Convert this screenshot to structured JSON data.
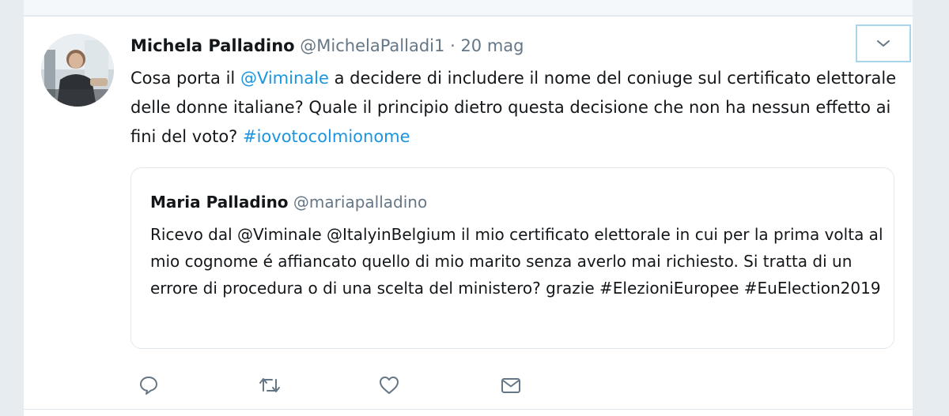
{
  "tweet": {
    "author_name": "Michela Palladino",
    "author_handle": "@MichelaPalladi1",
    "separator": "·",
    "date": "20 mag",
    "text": {
      "part1": "Cosa porta il ",
      "mention": "@Viminale",
      "part2": " a decidere di includere il nome del coniuge sul certificato elettorale delle donne italiane? Quale il principio dietro questa decisione che non ha nessun effetto ai fini del voto? ",
      "hashtag": "#iovotocolmionome"
    },
    "menu_icon": "chevron-down-icon"
  },
  "quoted_tweet": {
    "author_name": "Maria Palladino",
    "author_handle": "@mariapalladino",
    "text": "Ricevo dal @Viminale @ItalyinBelgium il mio certificato elettorale in cui per la prima volta al mio cognome é affiancato quello di mio marito senza averlo mai richiesto. Si tratta di un errore di procedura o di una scelta del ministero? grazie #ElezioniEuropee #EuElection2019"
  },
  "actions": [
    {
      "icon": "reply-icon"
    },
    {
      "icon": "retweet-icon"
    },
    {
      "icon": "like-icon"
    },
    {
      "icon": "direct-message-icon"
    }
  ],
  "colors": {
    "background": "#e6ecf0",
    "card": "#ffffff",
    "text": "#14171a",
    "secondary_text": "#657786",
    "link": "#1b95e0",
    "border": "#e1e8ed",
    "caret_border": "#a8d4ec"
  }
}
